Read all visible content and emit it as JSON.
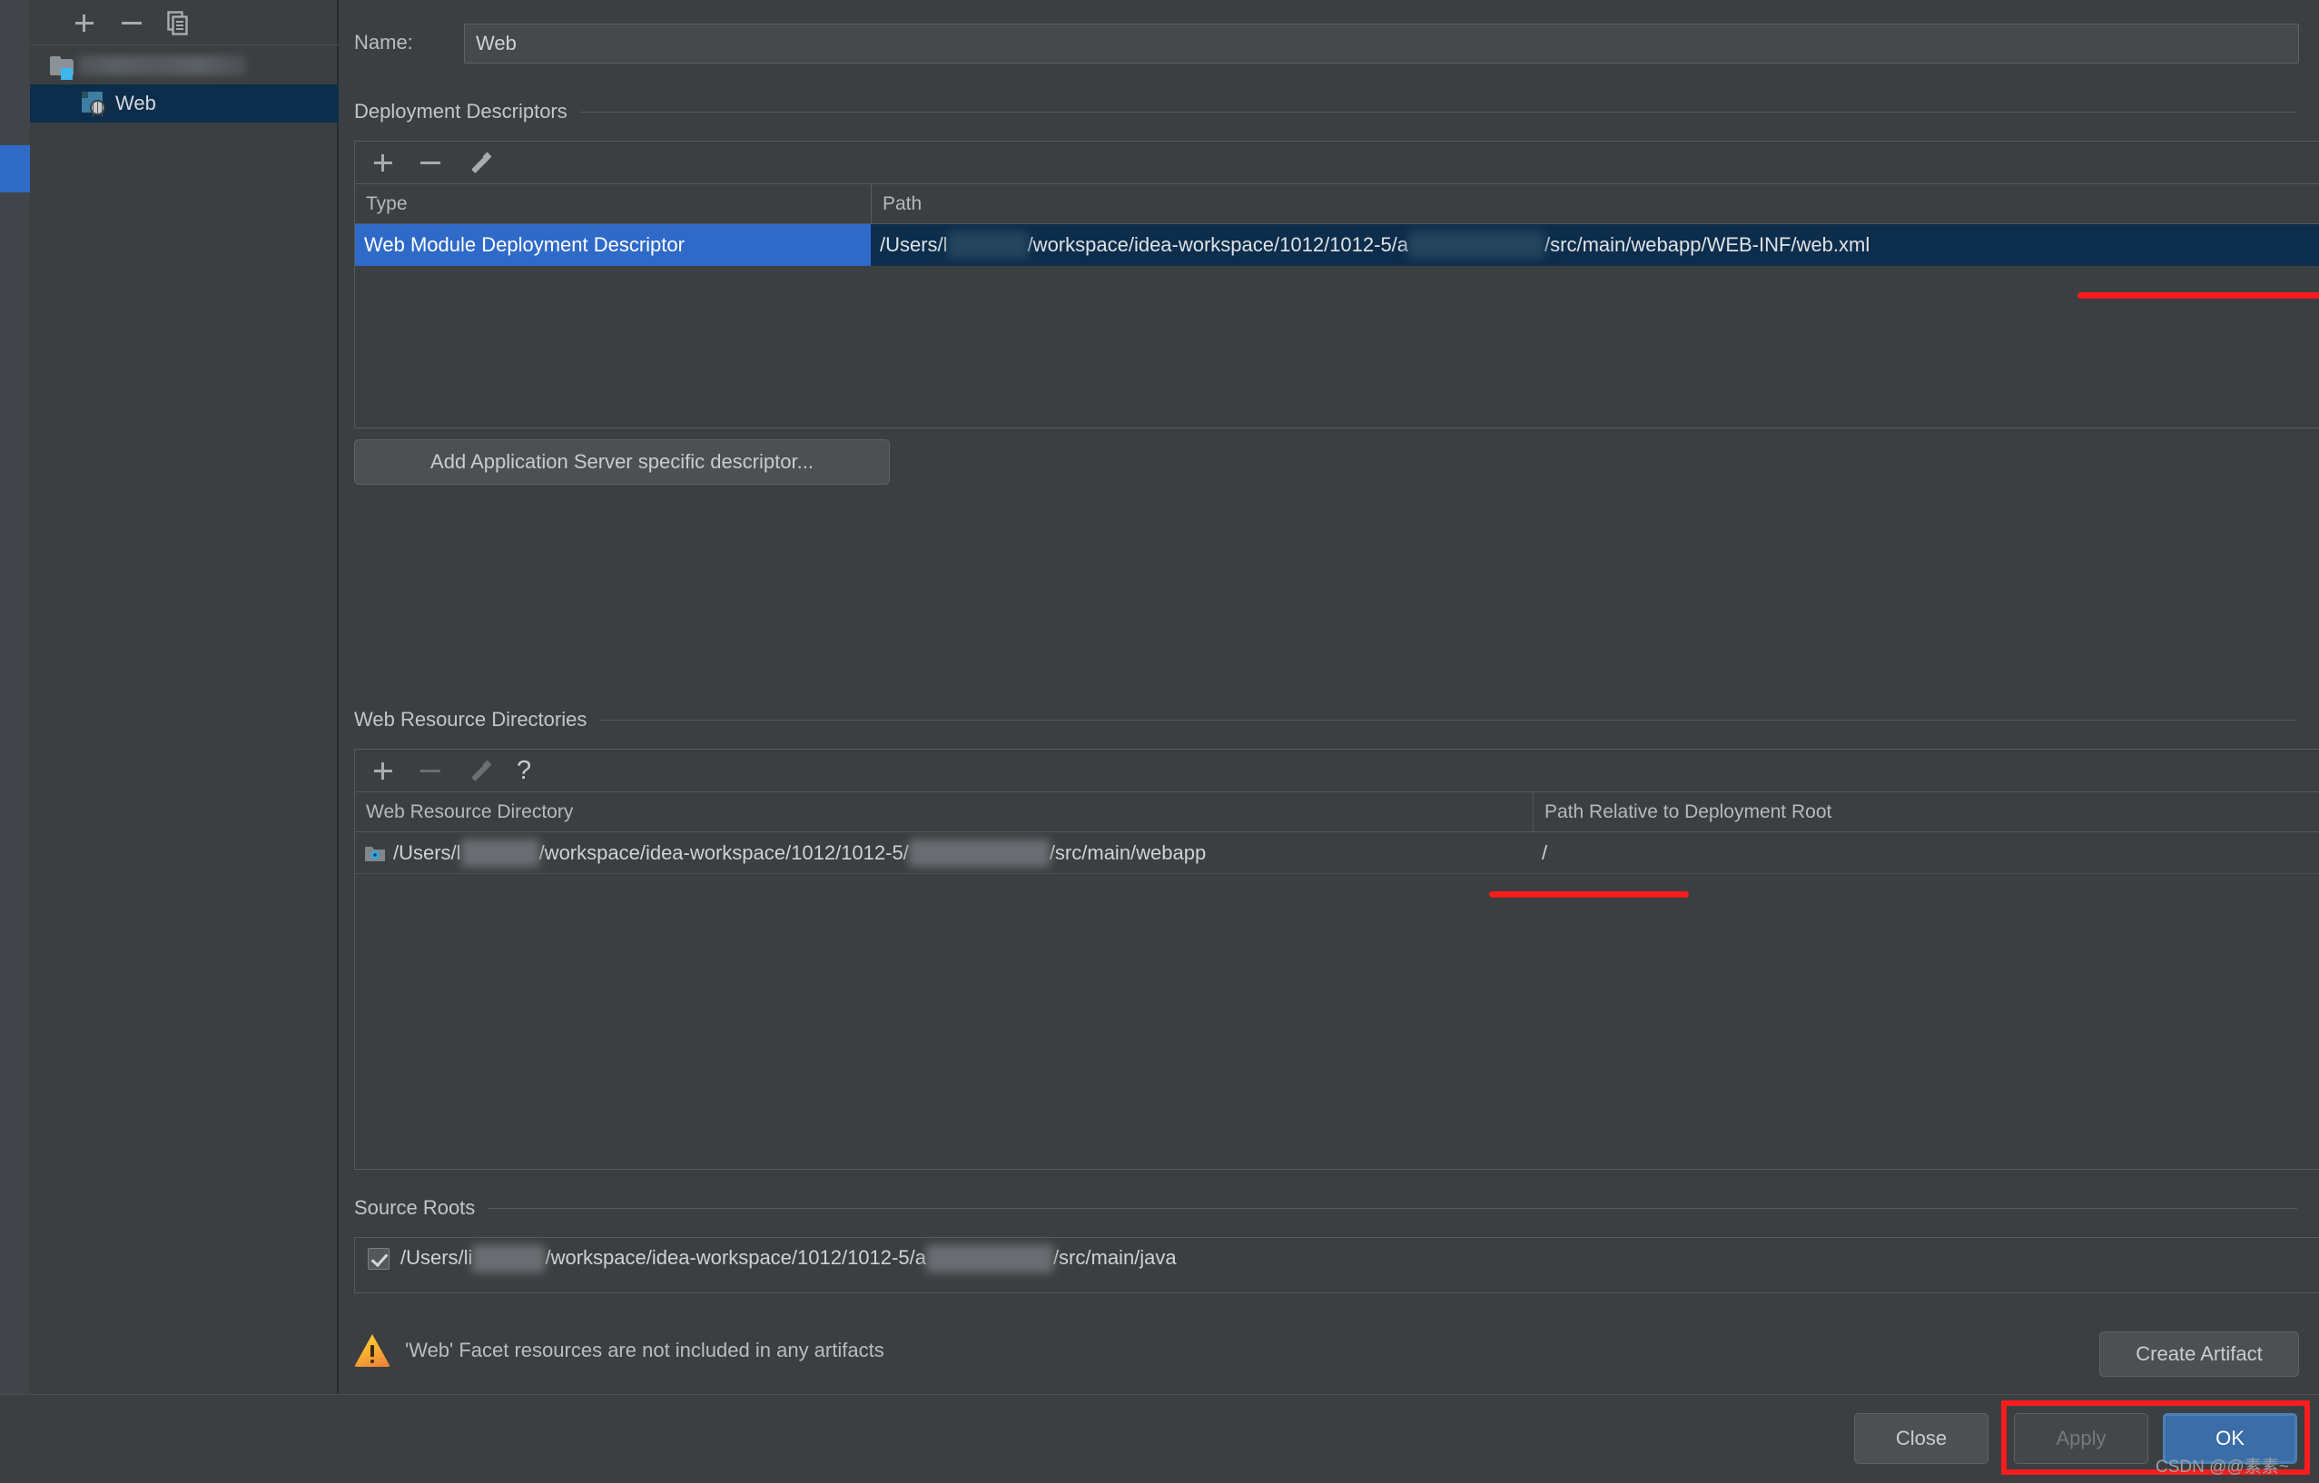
{
  "tree": {
    "toolbar": {
      "add": "add-icon",
      "remove": "remove-icon",
      "copy": "copy-icon"
    },
    "items": [
      {
        "label": "",
        "icon": "folder-icon",
        "blurred": true,
        "selected": false
      },
      {
        "label": "Web",
        "icon": "web-facet-icon",
        "blurred": false,
        "selected": true
      }
    ]
  },
  "name_field": {
    "label": "Name:",
    "value": "Web"
  },
  "deployment_descriptors": {
    "title": "Deployment Descriptors",
    "toolbar": [
      "add-icon",
      "remove-icon",
      "edit-pencil-icon"
    ],
    "columns": [
      "Type",
      "Path"
    ],
    "rows": [
      {
        "type": "Web Module Deployment Descriptor",
        "path_prefix": "/Users/l",
        "path_middle": "/workspace/idea-workspace/1012/1012-5/a",
        "path_suffix": "/src/main/webapp/WEB-INF/web.xml",
        "selected": true
      }
    ],
    "add_button": "Add Application Server specific descriptor..."
  },
  "web_resource_directories": {
    "title": "Web Resource Directories",
    "toolbar": [
      "add-icon",
      "remove-icon",
      "edit-pencil-icon",
      "help-question-icon"
    ],
    "columns": [
      "Web Resource Directory",
      "Path Relative to Deployment Root"
    ],
    "rows": [
      {
        "dir_prefix": "/Users/l",
        "dir_middle": "/workspace/idea-workspace/1012/1012-5/",
        "dir_suffix": "/src/main/webapp",
        "relative_path": "/"
      }
    ]
  },
  "source_roots": {
    "title": "Source Roots",
    "rows": [
      {
        "checked": true,
        "prefix": "/Users/li",
        "middle": "/workspace/idea-workspace/1012/1012-5/a",
        "suffix": "/src/main/java"
      }
    ]
  },
  "warning": {
    "icon": "warning-triangle-icon",
    "message": "'Web' Facet resources are not included in any artifacts",
    "action_button": "Create Artifact"
  },
  "dialog_buttons": {
    "close": "Close",
    "apply": "Apply",
    "ok": "OK"
  },
  "annotations": {
    "highlight_color": "#f81c1c",
    "underline_webxml": "/src/main/webapp/WEB-INF/web.xml",
    "underline_webapp": "/src/main/webapp",
    "box_targets": [
      "Apply",
      "OK"
    ]
  },
  "watermark": "CSDN @@素素~",
  "colors": {
    "background": "#3c3f41",
    "selection_blue": "#2f6ac9",
    "row_selected_dark": "#0d2d4c",
    "primary_button": "#3b6ea8",
    "accent_red": "#f81c1c",
    "warning_orange": "#efa117"
  }
}
